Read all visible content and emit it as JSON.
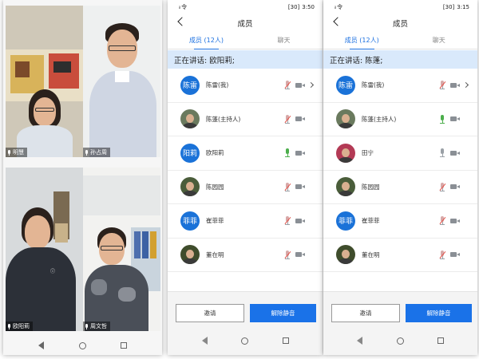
{
  "video_grid": {
    "participants": [
      {
        "name": "明慧"
      },
      {
        "name": "孙占周"
      },
      {
        "name": "欧阳莉"
      },
      {
        "name": "周文哲"
      }
    ]
  },
  "screens": [
    {
      "status_time": "3:50",
      "status_signal": "ᵢₗ 令",
      "battery_text": "[30]",
      "title": "成员",
      "tab_members": "成员 (12人)",
      "tab_chat": "聊天",
      "speaking_text": "正在讲话: 欧阳莉;",
      "members": [
        {
          "avatar_text": "陈雷",
          "name": "陈雷(我)",
          "photo": false,
          "mic": "muted",
          "chevron": true
        },
        {
          "avatar_text": "",
          "name": "陈蓬(主持人)",
          "photo": true,
          "mic": "muted",
          "chevron": false
        },
        {
          "avatar_text": "阳莉",
          "name": "欧阳莉",
          "photo": false,
          "mic": "green",
          "chevron": false
        },
        {
          "avatar_text": "",
          "name": "陈园园",
          "photo": true,
          "mic": "muted",
          "chevron": false
        },
        {
          "avatar_text": "菲菲",
          "name": "崔菲菲",
          "photo": false,
          "mic": "muted",
          "chevron": false
        },
        {
          "avatar_text": "",
          "name": "董在明",
          "photo": true,
          "mic": "muted",
          "chevron": false
        }
      ],
      "invite_label": "邀请",
      "unmute_label": "解除静音"
    },
    {
      "status_time": "3:15",
      "status_signal": "ᵢₗ 令",
      "battery_text": "[30]",
      "title": "成员",
      "tab_members": "成员 (12人)",
      "tab_chat": "聊天",
      "speaking_text": "正在讲话: 陈蓬;",
      "members": [
        {
          "avatar_text": "陈雷",
          "name": "陈雷(我)",
          "photo": false,
          "mic": "muted",
          "chevron": true
        },
        {
          "avatar_text": "",
          "name": "陈蓬(主持人)",
          "photo": true,
          "mic": "green",
          "chevron": false
        },
        {
          "avatar_text": "",
          "name": "田宁",
          "photo": true,
          "mic": "normal",
          "chevron": false
        },
        {
          "avatar_text": "",
          "name": "陈园园",
          "photo": true,
          "mic": "muted",
          "chevron": false
        },
        {
          "avatar_text": "菲菲",
          "name": "崔菲菲",
          "photo": false,
          "mic": "muted",
          "chevron": false
        },
        {
          "avatar_text": "",
          "name": "董在明",
          "photo": true,
          "mic": "muted",
          "chevron": false
        }
      ],
      "invite_label": "邀请",
      "unmute_label": "解除静音"
    }
  ],
  "colors": {
    "accent": "#1a72e8",
    "speaking_bar": "#d9e9fb",
    "mic_active": "#4cae4c",
    "mic_muted": "#e0534a"
  }
}
